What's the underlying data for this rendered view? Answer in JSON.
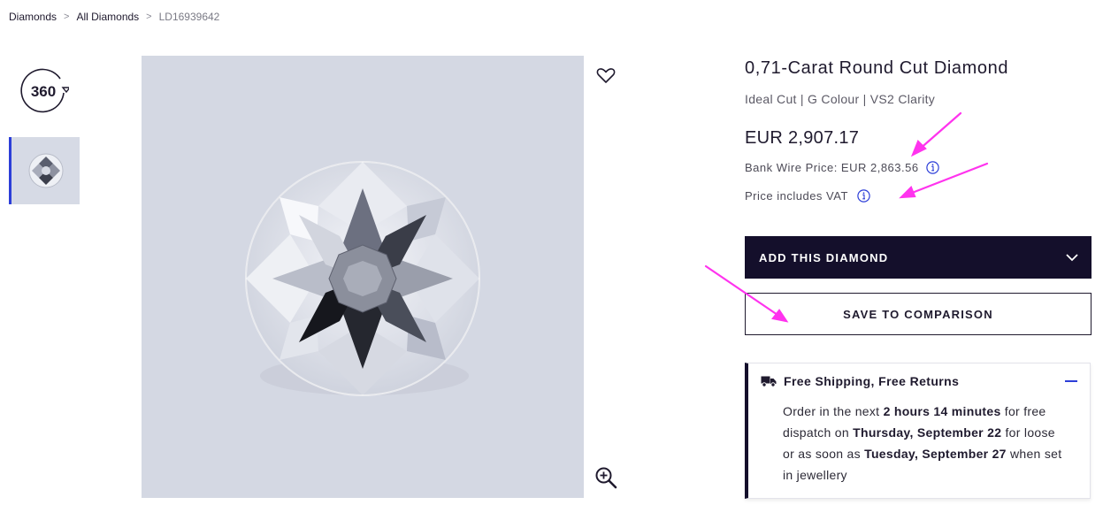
{
  "breadcrumb": {
    "items": [
      {
        "label": "Diamonds"
      },
      {
        "label": "All Diamonds"
      }
    ],
    "separator": ">",
    "current": "LD16939642"
  },
  "thumbnails": {
    "view360_label": "360"
  },
  "product": {
    "title": "0,71-Carat Round Cut Diamond",
    "subtitle": "Ideal Cut | G Colour | VS2 Clarity",
    "price": "EUR 2,907.17",
    "wire_price": "Bank Wire Price: EUR 2,863.56",
    "vat_note": "Price includes VAT"
  },
  "actions": {
    "add_label": "ADD THIS DIAMOND",
    "compare_label": "SAVE TO COMPARISON"
  },
  "shipping": {
    "heading": "Free Shipping, Free Returns",
    "line1_prefix": "Order in the next ",
    "line1_time": "2 hours 14 minutes",
    "line1_suffix": " for free dispatch on ",
    "dispatch_date": "Thursday, September 22",
    "line2": " for loose or as soon as ",
    "set_date": "Tuesday, September 27",
    "line3": " when set in jewellery"
  },
  "icons": {
    "wishlist": "heart-icon",
    "zoom": "zoom-in-icon",
    "info": "info-icon",
    "dropdown": "chevron-down-icon",
    "shipping": "truck-icon",
    "collapse": "minus-icon"
  },
  "colors": {
    "primary_dark": "#140f2b",
    "accent_blue": "#2c3ed8",
    "annotation": "#ff33ee",
    "image_bg": "#d4d8e3"
  }
}
